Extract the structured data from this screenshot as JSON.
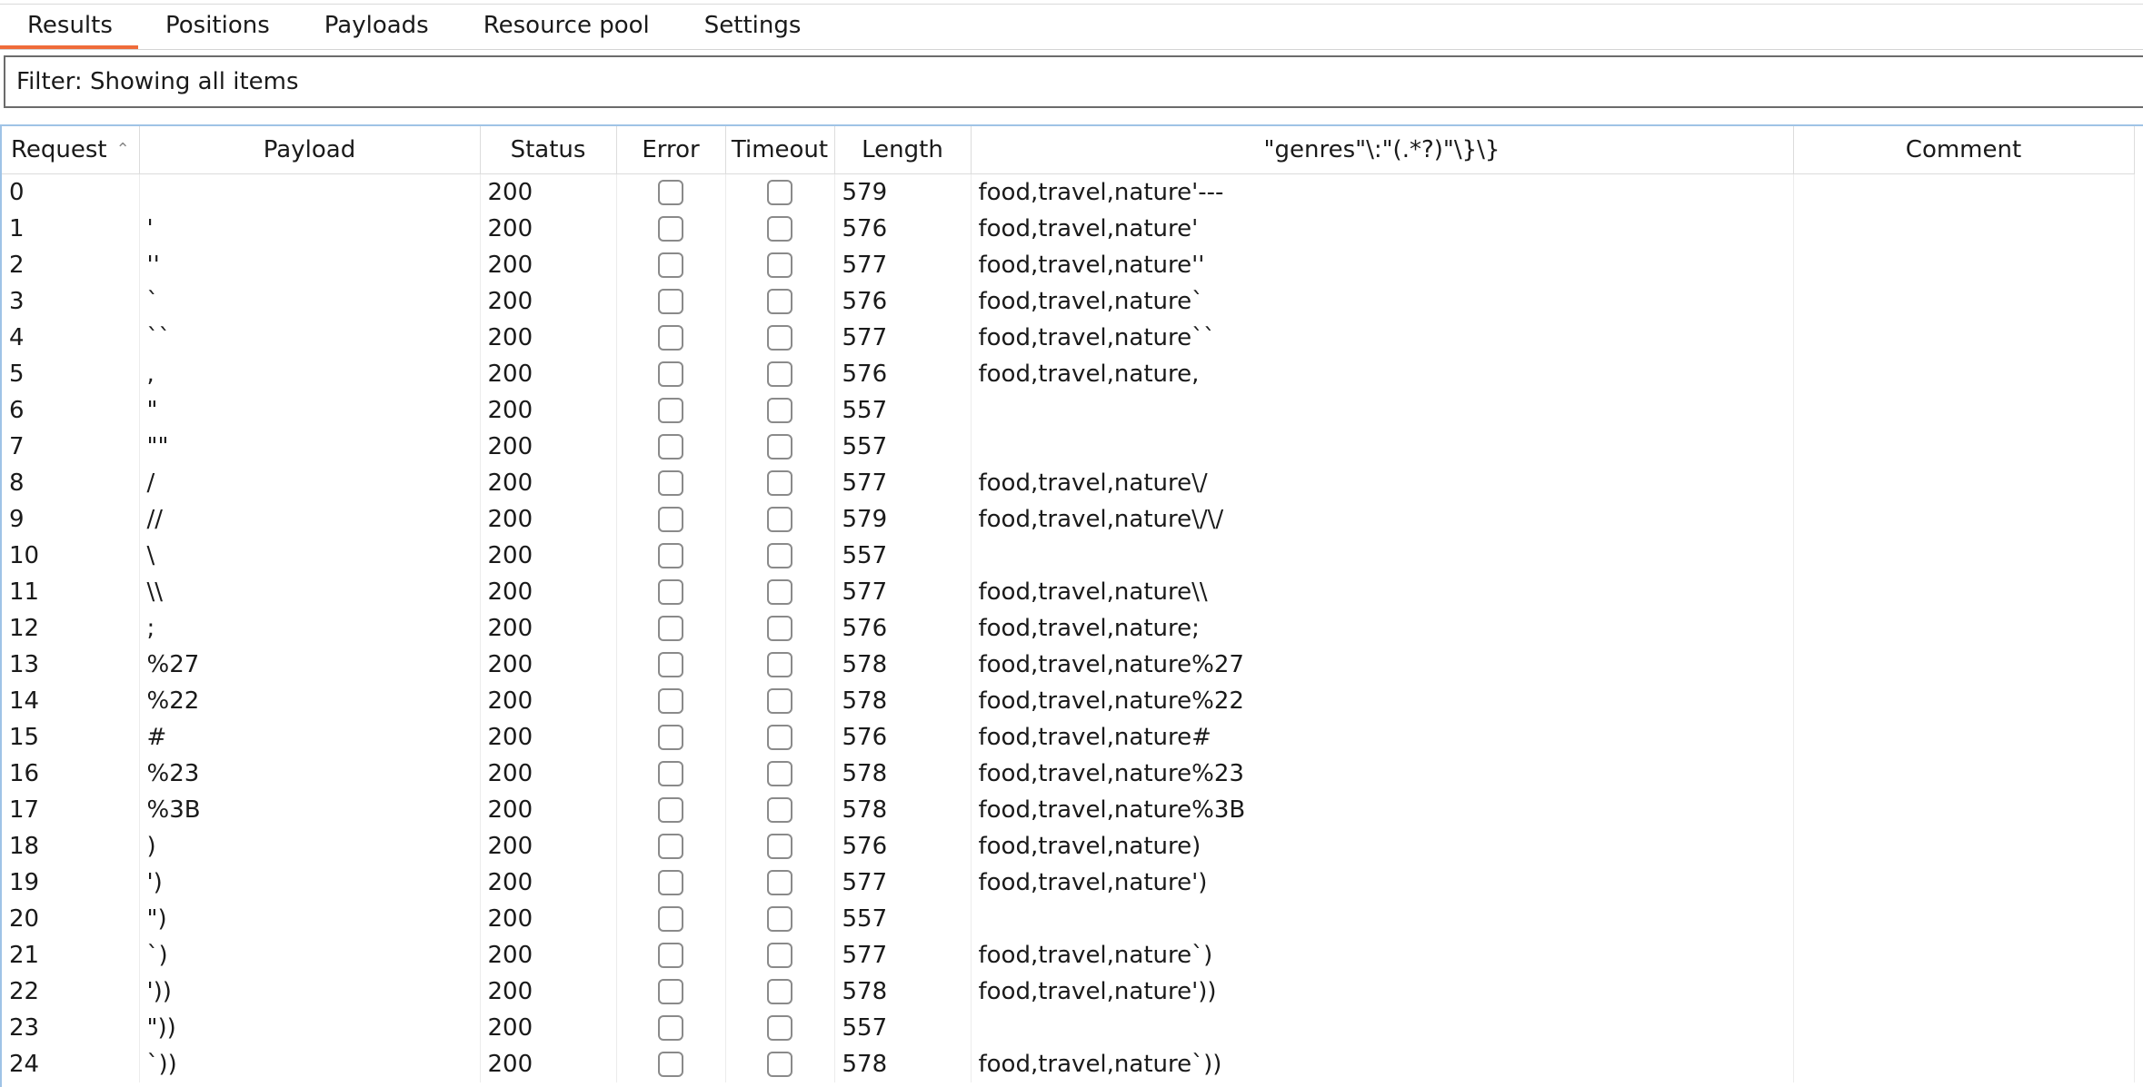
{
  "tabs": [
    {
      "label": "Results",
      "active": true
    },
    {
      "label": "Positions",
      "active": false
    },
    {
      "label": "Payloads",
      "active": false
    },
    {
      "label": "Resource pool",
      "active": false
    },
    {
      "label": "Settings",
      "active": false
    }
  ],
  "filter": {
    "label": "Filter: Showing all items"
  },
  "table": {
    "columns": [
      "Request",
      "Payload",
      "Status",
      "Error",
      "Timeout",
      "Length",
      "\"genres\"\\:\"(.*?)\"\\}\\}",
      "Comment"
    ],
    "sort_icon": "chevron-up-icon",
    "rows": [
      {
        "request": "0",
        "payload": "",
        "status": "200",
        "length": "579",
        "genres": "food,travel,nature'---",
        "comment": ""
      },
      {
        "request": "1",
        "payload": "'",
        "status": "200",
        "length": "576",
        "genres": "food,travel,nature'",
        "comment": ""
      },
      {
        "request": "2",
        "payload": "''",
        "status": "200",
        "length": "577",
        "genres": "food,travel,nature''",
        "comment": ""
      },
      {
        "request": "3",
        "payload": "`",
        "status": "200",
        "length": "576",
        "genres": "food,travel,nature`",
        "comment": ""
      },
      {
        "request": "4",
        "payload": "``",
        "status": "200",
        "length": "577",
        "genres": "food,travel,nature``",
        "comment": ""
      },
      {
        "request": "5",
        "payload": ",",
        "status": "200",
        "length": "576",
        "genres": "food,travel,nature,",
        "comment": ""
      },
      {
        "request": "6",
        "payload": "\"",
        "status": "200",
        "length": "557",
        "genres": "",
        "comment": ""
      },
      {
        "request": "7",
        "payload": "\"\"",
        "status": "200",
        "length": "557",
        "genres": "",
        "comment": ""
      },
      {
        "request": "8",
        "payload": "/",
        "status": "200",
        "length": "577",
        "genres": "food,travel,nature\\/",
        "comment": ""
      },
      {
        "request": "9",
        "payload": "//",
        "status": "200",
        "length": "579",
        "genres": "food,travel,nature\\/\\/",
        "comment": ""
      },
      {
        "request": "10",
        "payload": "\\",
        "status": "200",
        "length": "557",
        "genres": "",
        "comment": ""
      },
      {
        "request": "11",
        "payload": "\\\\",
        "status": "200",
        "length": "577",
        "genres": "food,travel,nature\\\\",
        "comment": ""
      },
      {
        "request": "12",
        "payload": ";",
        "status": "200",
        "length": "576",
        "genres": "food,travel,nature;",
        "comment": ""
      },
      {
        "request": "13",
        "payload": "%27",
        "status": "200",
        "length": "578",
        "genres": "food,travel,nature%27",
        "comment": ""
      },
      {
        "request": "14",
        "payload": "%22",
        "status": "200",
        "length": "578",
        "genres": "food,travel,nature%22",
        "comment": ""
      },
      {
        "request": "15",
        "payload": "#",
        "status": "200",
        "length": "576",
        "genres": "food,travel,nature#",
        "comment": ""
      },
      {
        "request": "16",
        "payload": "%23",
        "status": "200",
        "length": "578",
        "genres": "food,travel,nature%23",
        "comment": ""
      },
      {
        "request": "17",
        "payload": "%3B",
        "status": "200",
        "length": "578",
        "genres": "food,travel,nature%3B",
        "comment": ""
      },
      {
        "request": "18",
        "payload": ")",
        "status": "200",
        "length": "576",
        "genres": "food,travel,nature)",
        "comment": ""
      },
      {
        "request": "19",
        "payload": "')",
        "status": "200",
        "length": "577",
        "genres": "food,travel,nature')",
        "comment": ""
      },
      {
        "request": "20",
        "payload": "\")",
        "status": "200",
        "length": "557",
        "genres": "",
        "comment": ""
      },
      {
        "request": "21",
        "payload": "`)",
        "status": "200",
        "length": "577",
        "genres": "food,travel,nature`)",
        "comment": ""
      },
      {
        "request": "22",
        "payload": "'))",
        "status": "200",
        "length": "578",
        "genres": "food,travel,nature'))",
        "comment": ""
      },
      {
        "request": "23",
        "payload": "\"))",
        "status": "200",
        "length": "557",
        "genres": "",
        "comment": ""
      },
      {
        "request": "24",
        "payload": "`))",
        "status": "200",
        "length": "578",
        "genres": "food,travel,nature`))",
        "comment": ""
      }
    ]
  }
}
